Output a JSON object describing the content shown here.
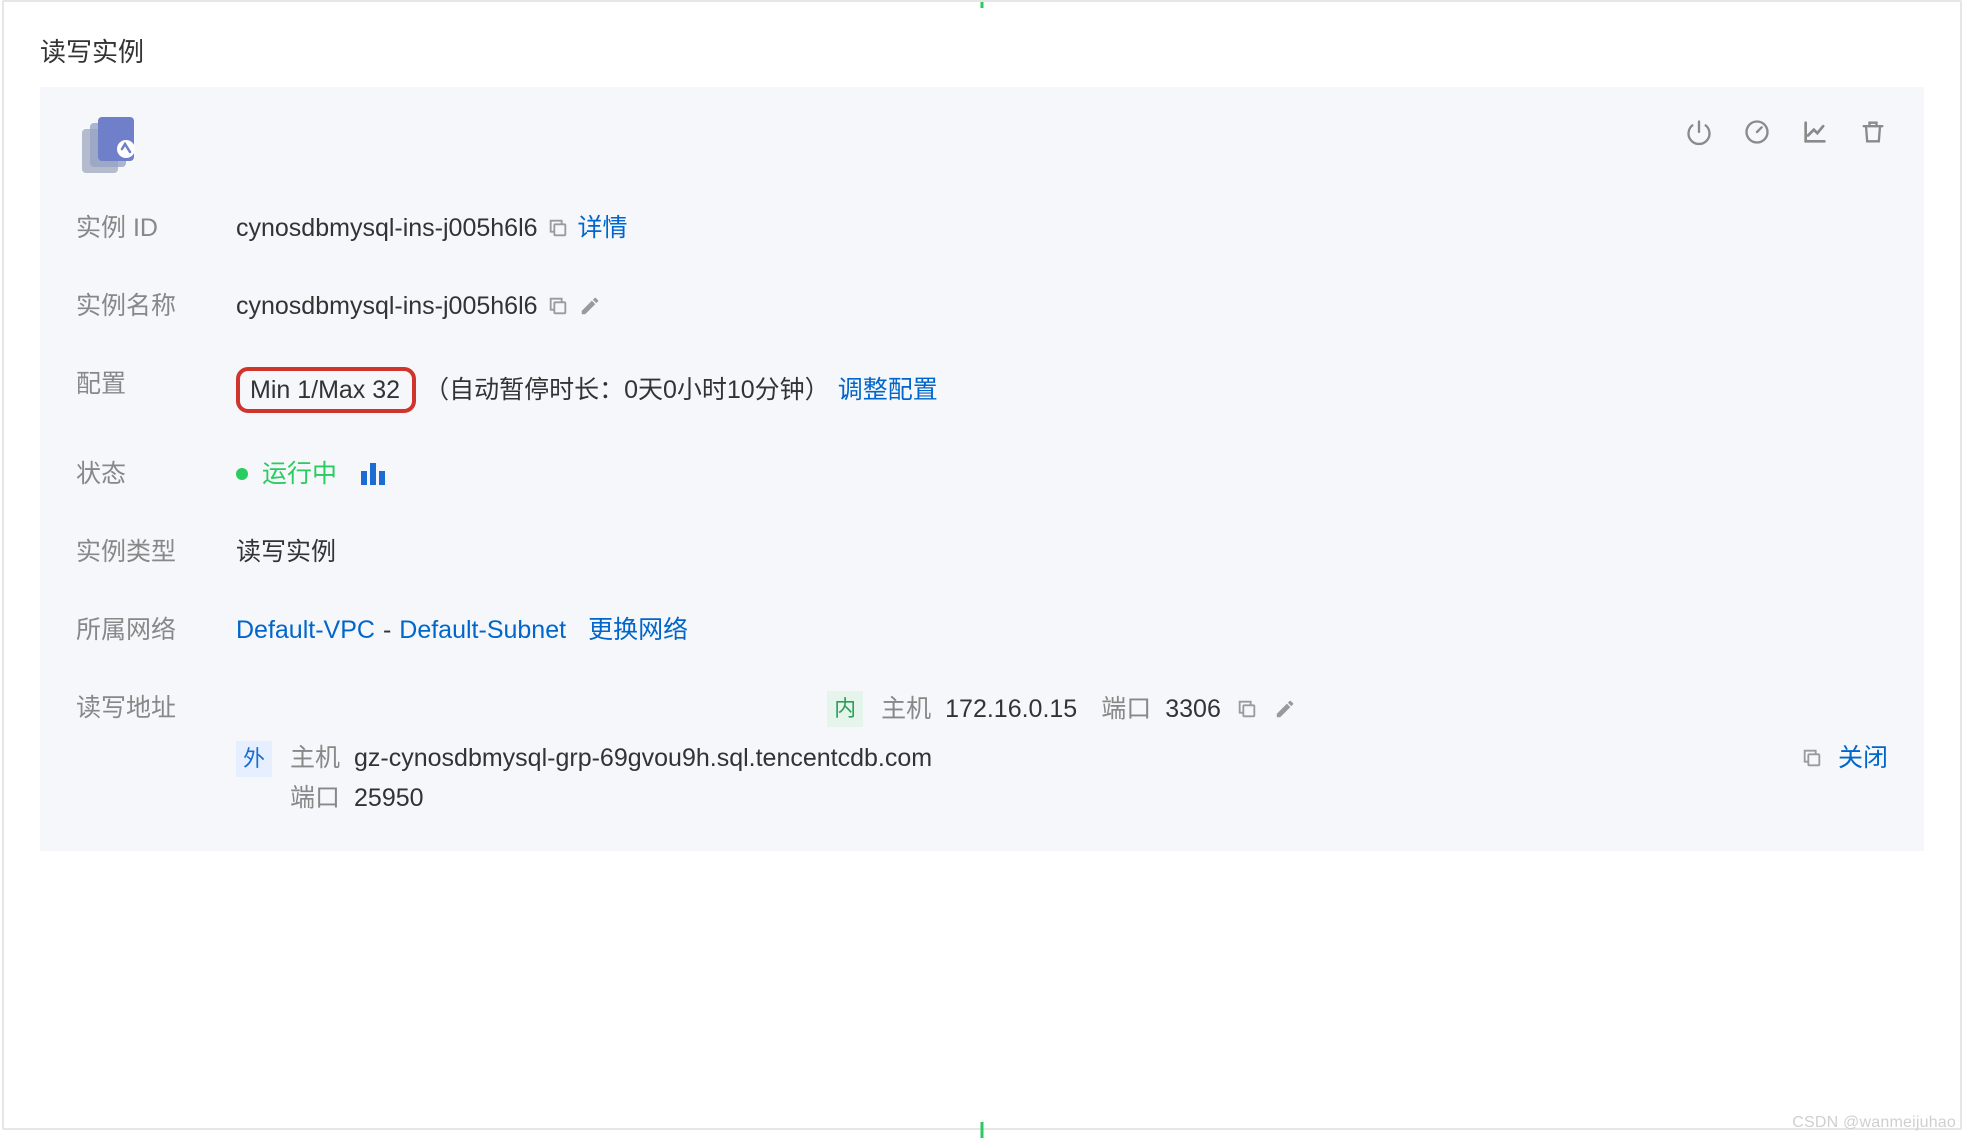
{
  "section_title": "读写实例",
  "actions": {
    "power_name": "power-icon",
    "gauge_name": "gauge-icon",
    "chart_name": "chart-icon",
    "delete_name": "trash-icon"
  },
  "labels": {
    "instance_id": "实例 ID",
    "instance_name": "实例名称",
    "config": "配置",
    "status": "状态",
    "instance_type": "实例类型",
    "network": "所属网络",
    "rw_address": "读写地址"
  },
  "instance": {
    "id": "cynosdbmysql-ins-j005h6l6",
    "detail_link": "详情",
    "name": "cynosdbmysql-ins-j005h6l6",
    "config_minmax": "Min 1/Max 32",
    "config_autopause": "（自动暂停时长：0天0小时10分钟）",
    "config_adjust_link": "调整配置",
    "status_text": "运行中",
    "type": "读写实例",
    "vpc": "Default-VPC",
    "network_sep": " - ",
    "subnet": "Default-Subnet",
    "change_network_link": "更换网络"
  },
  "address": {
    "internal_badge": "内",
    "external_badge": "外",
    "host_label": "主机",
    "port_label": "端口",
    "internal_host": "172.16.0.15",
    "internal_port": "3306",
    "external_host": "gz-cynosdbmysql-grp-69gvou9h.sql.tencentcdb.com",
    "external_port": "25950",
    "close_link": "关闭"
  },
  "watermark": "CSDN @wanmeijuhao"
}
